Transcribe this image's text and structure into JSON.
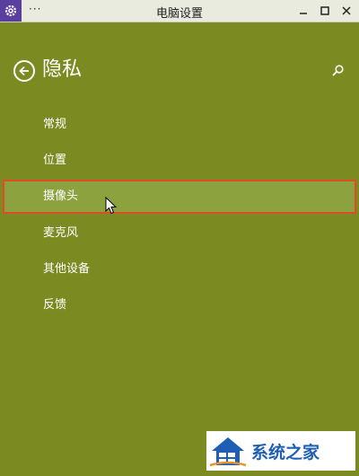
{
  "window": {
    "title": "电脑设置",
    "system_menu": "···"
  },
  "header": {
    "title": "隐私"
  },
  "nav": {
    "items": [
      {
        "label": "常规"
      },
      {
        "label": "位置"
      },
      {
        "label": "摄像头",
        "selected": true
      },
      {
        "label": "麦克风"
      },
      {
        "label": "其他设备"
      },
      {
        "label": "反馈"
      }
    ]
  },
  "watermark": {
    "text": "系统之家"
  },
  "colors": {
    "background": "#7b8b21",
    "selected_item": "#8ca23e",
    "highlight_border": "#e24a2a",
    "titlebar": "#e9ebdf",
    "app_icon": "#5a3ea0"
  }
}
